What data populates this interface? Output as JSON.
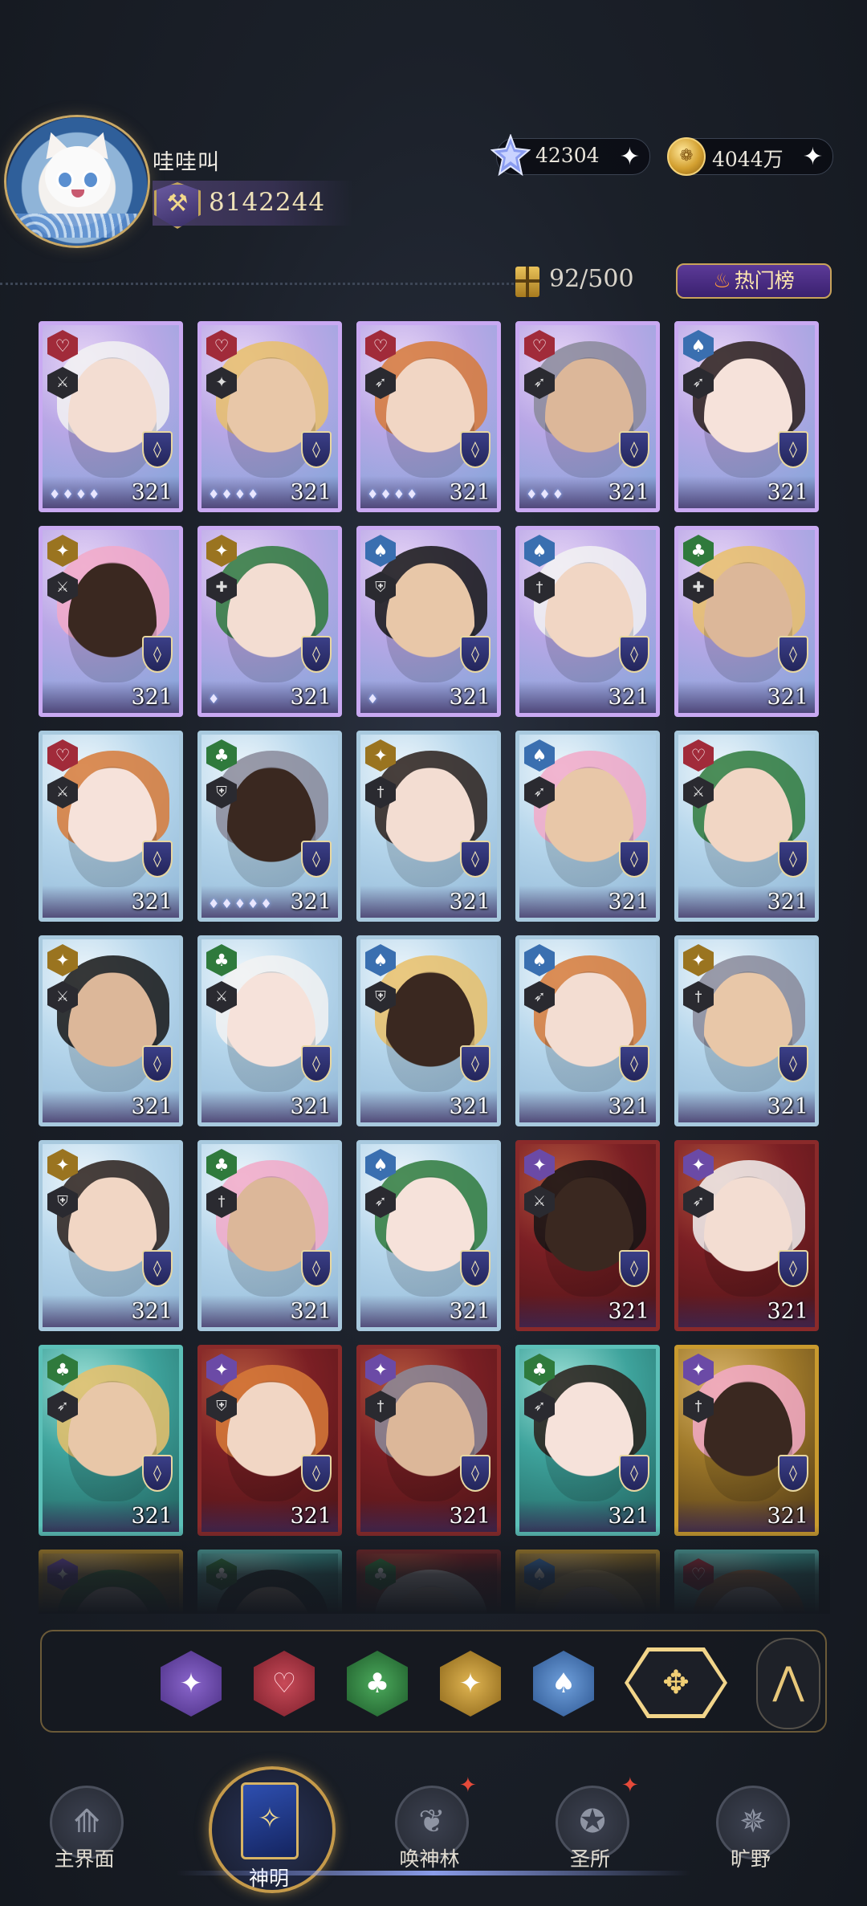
{
  "profile": {
    "name": "哇哇叫",
    "power": "8142244"
  },
  "currencies": {
    "gems": {
      "value": "42304",
      "icon": "star-gem-icon"
    },
    "gold": {
      "value": "4044万",
      "icon": "gold-coin-icon"
    }
  },
  "inventory": {
    "capacity": "92/500",
    "hot_button": "热门榜"
  },
  "cards": [
    {
      "suit": "heart",
      "frame": "purple",
      "level": "321",
      "stars": "♦♦♦♦",
      "role": "⚔"
    },
    {
      "suit": "heart",
      "frame": "purple",
      "level": "321",
      "stars": "♦♦♦♦",
      "role": "✦"
    },
    {
      "suit": "heart",
      "frame": "purple",
      "level": "321",
      "stars": "♦♦♦♦",
      "role": "➶"
    },
    {
      "suit": "heart",
      "frame": "purple",
      "level": "321",
      "stars": "♦♦♦",
      "role": "➶"
    },
    {
      "suit": "spade",
      "frame": "purple",
      "level": "321",
      "stars": "",
      "role": "➶"
    },
    {
      "suit": "diamond",
      "frame": "purple",
      "level": "321",
      "stars": "",
      "role": "⚔"
    },
    {
      "suit": "diamond",
      "frame": "purple",
      "level": "321",
      "stars": "♦",
      "role": "✚"
    },
    {
      "suit": "spade",
      "frame": "purple",
      "level": "321",
      "stars": "♦",
      "role": "⛨"
    },
    {
      "suit": "spade",
      "frame": "purple",
      "level": "321",
      "stars": "",
      "role": "†"
    },
    {
      "suit": "club",
      "frame": "purple",
      "level": "321",
      "stars": "",
      "role": "✚"
    },
    {
      "suit": "heart",
      "frame": "blue",
      "level": "321",
      "stars": "",
      "role": "⚔"
    },
    {
      "suit": "club",
      "frame": "blue",
      "level": "321",
      "stars": "♦♦♦♦♦",
      "role": "⛨"
    },
    {
      "suit": "diamond",
      "frame": "blue",
      "level": "321",
      "stars": "",
      "role": "†"
    },
    {
      "suit": "spade",
      "frame": "blue",
      "level": "321",
      "stars": "",
      "role": "➶"
    },
    {
      "suit": "heart",
      "frame": "blue",
      "level": "321",
      "stars": "",
      "role": "⚔"
    },
    {
      "suit": "diamond",
      "frame": "blue",
      "level": "321",
      "stars": "",
      "role": "⚔"
    },
    {
      "suit": "club",
      "frame": "blue",
      "level": "321",
      "stars": "",
      "role": "⚔"
    },
    {
      "suit": "spade",
      "frame": "blue",
      "level": "321",
      "stars": "",
      "role": "⛨"
    },
    {
      "suit": "spade",
      "frame": "blue",
      "level": "321",
      "stars": "",
      "role": "➶"
    },
    {
      "suit": "diamond",
      "frame": "blue",
      "level": "321",
      "stars": "",
      "role": "†"
    },
    {
      "suit": "diamond",
      "frame": "blue",
      "level": "321",
      "stars": "",
      "role": "⛨"
    },
    {
      "suit": "club",
      "frame": "blue",
      "level": "321",
      "stars": "",
      "role": "†"
    },
    {
      "suit": "spade",
      "frame": "blue",
      "level": "321",
      "stars": "",
      "role": "➶"
    },
    {
      "suit": "star",
      "frame": "red",
      "level": "321",
      "stars": "",
      "role": "⚔"
    },
    {
      "suit": "star",
      "frame": "red",
      "level": "321",
      "stars": "",
      "role": "➶"
    },
    {
      "suit": "club",
      "frame": "teal",
      "level": "321",
      "stars": "",
      "role": "➶"
    },
    {
      "suit": "star",
      "frame": "red",
      "level": "321",
      "stars": "",
      "role": "⛨"
    },
    {
      "suit": "star",
      "frame": "red",
      "level": "321",
      "stars": "",
      "role": "†"
    },
    {
      "suit": "club",
      "frame": "teal",
      "level": "321",
      "stars": "",
      "role": "➶"
    },
    {
      "suit": "star",
      "frame": "gold",
      "level": "321",
      "stars": "",
      "role": "†"
    },
    {
      "suit": "star",
      "frame": "gold",
      "level": "",
      "stars": "",
      "role": ""
    },
    {
      "suit": "club",
      "frame": "teal",
      "level": "",
      "stars": "",
      "role": ""
    },
    {
      "suit": "club",
      "frame": "red",
      "level": "",
      "stars": "",
      "role": ""
    },
    {
      "suit": "spade",
      "frame": "gold",
      "level": "",
      "stars": "",
      "role": ""
    },
    {
      "suit": "heart",
      "frame": "teal",
      "level": "",
      "stars": "",
      "role": ""
    }
  ],
  "filters": [
    {
      "name": "star",
      "icon": "star-suit-icon",
      "glyph": "✦"
    },
    {
      "name": "heart",
      "icon": "heart-suit-icon",
      "glyph": "♡"
    },
    {
      "name": "club",
      "icon": "club-suit-icon",
      "glyph": "♣"
    },
    {
      "name": "diamond",
      "icon": "diamond-suit-icon",
      "glyph": "✦"
    },
    {
      "name": "spade",
      "icon": "spade-suit-icon",
      "glyph": "♠"
    }
  ],
  "filter_all_icon": "all-suits-icon",
  "nav": {
    "main": "主界面",
    "gods": "神明",
    "summon": "唤神林",
    "sanctuary": "圣所",
    "wilds": "旷野"
  },
  "colors": {
    "accent_gold": "#c9a35a",
    "heart": "#a12b3a",
    "star": "#6b4aa6",
    "club": "#2f7a3c",
    "diamond": "#9a7420",
    "spade": "#3a6fb0",
    "notification": "#e54a3a"
  }
}
